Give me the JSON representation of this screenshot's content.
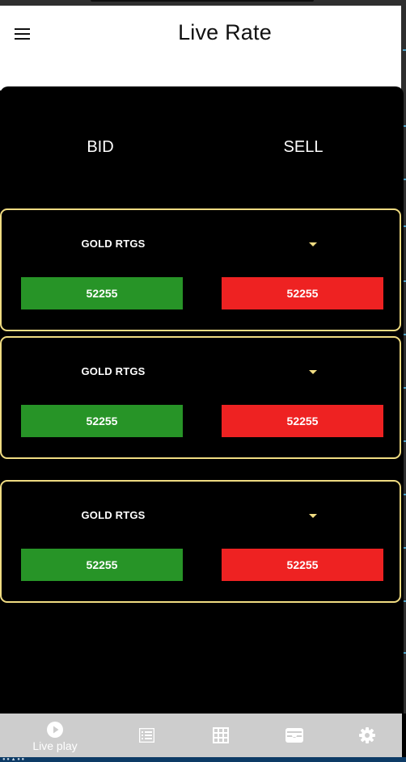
{
  "app": {
    "title": "Live Rate"
  },
  "columns": {
    "bid": "BID",
    "sell": "SELL"
  },
  "rates": [
    {
      "name": "GOLD RTGS",
      "bid": "52255",
      "sell": "52255"
    },
    {
      "name": "GOLD RTGS",
      "bid": "52255",
      "sell": "52255"
    },
    {
      "name": "GOLD RTGS",
      "bid": "52255",
      "sell": "52255"
    }
  ],
  "bottom_nav": {
    "items": [
      {
        "icon": "play-circle-icon",
        "label": "Live play"
      },
      {
        "icon": "list-icon"
      },
      {
        "icon": "grid-icon"
      },
      {
        "icon": "wallet-icon"
      },
      {
        "icon": "gear-icon"
      }
    ]
  },
  "colors": {
    "bid": "#279427",
    "sell": "#ee2222",
    "card_border": "#f0dc82",
    "background": "#000000",
    "nav_background": "#cdcdcd"
  }
}
